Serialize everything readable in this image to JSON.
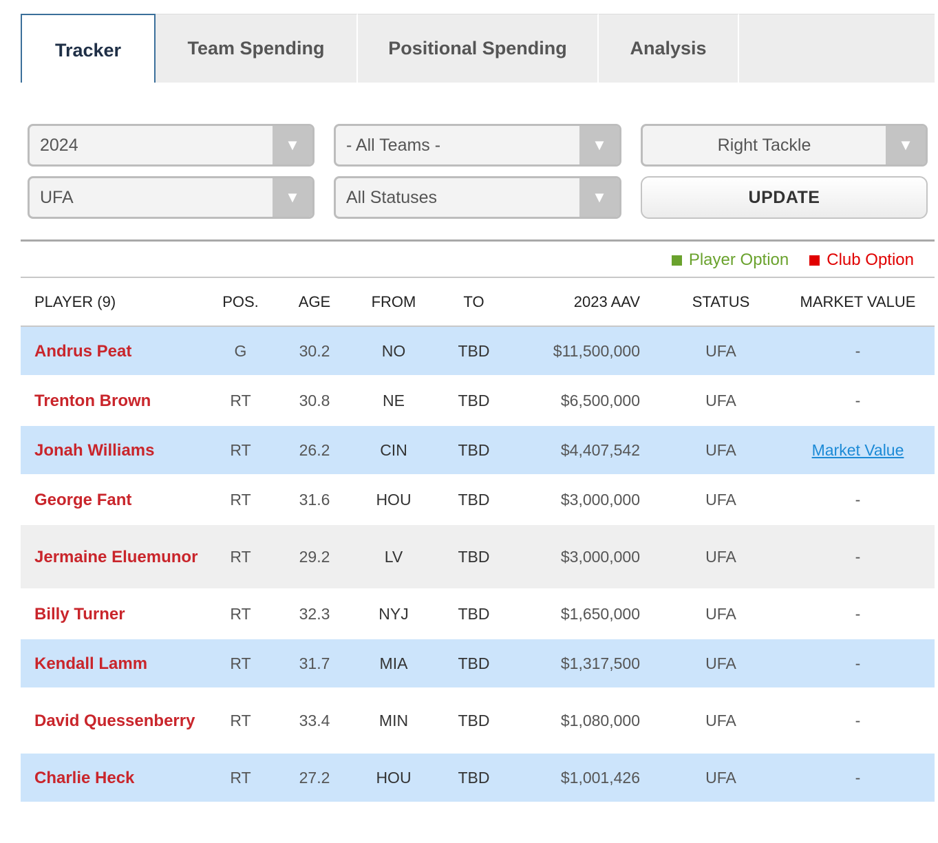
{
  "tabs": [
    {
      "label": "Tracker",
      "active": true
    },
    {
      "label": "Team Spending",
      "active": false
    },
    {
      "label": "Positional Spending",
      "active": false
    },
    {
      "label": "Analysis",
      "active": false
    }
  ],
  "filters": {
    "year": "2024",
    "team": "- All Teams -",
    "position": "Right Tackle",
    "type": "UFA",
    "status": "All Statuses",
    "update_label": "UPDATE"
  },
  "legend": {
    "player_option": "Player Option",
    "player_option_color": "#6aa22d",
    "club_option": "Club Option",
    "club_option_color": "#e00000"
  },
  "table": {
    "headers": [
      "PLAYER (9)",
      "POS.",
      "AGE",
      "FROM",
      "TO",
      "2023 AAV",
      "STATUS",
      "MARKET VALUE"
    ],
    "rows": [
      {
        "player": "Andrus Peat",
        "pos": "G",
        "age": "30.2",
        "from": "NO",
        "to": "TBD",
        "aav": "$11,500,000",
        "status": "UFA",
        "mv": "-"
      },
      {
        "player": "Trenton Brown",
        "pos": "RT",
        "age": "30.8",
        "from": "NE",
        "to": "TBD",
        "aav": "$6,500,000",
        "status": "UFA",
        "mv": "-"
      },
      {
        "player": "Jonah Williams",
        "pos": "RT",
        "age": "26.2",
        "from": "CIN",
        "to": "TBD",
        "aav": "$4,407,542",
        "status": "UFA",
        "mv": "Market Value"
      },
      {
        "player": "George Fant",
        "pos": "RT",
        "age": "31.6",
        "from": "HOU",
        "to": "TBD",
        "aav": "$3,000,000",
        "status": "UFA",
        "mv": "-"
      },
      {
        "player": "Jermaine Eluemunor",
        "pos": "RT",
        "age": "29.2",
        "from": "LV",
        "to": "TBD",
        "aav": "$3,000,000",
        "status": "UFA",
        "mv": "-"
      },
      {
        "player": "Billy Turner",
        "pos": "RT",
        "age": "32.3",
        "from": "NYJ",
        "to": "TBD",
        "aav": "$1,650,000",
        "status": "UFA",
        "mv": "-"
      },
      {
        "player": "Kendall Lamm",
        "pos": "RT",
        "age": "31.7",
        "from": "MIA",
        "to": "TBD",
        "aav": "$1,317,500",
        "status": "UFA",
        "mv": "-"
      },
      {
        "player": "David Quessenberry",
        "pos": "RT",
        "age": "33.4",
        "from": "MIN",
        "to": "TBD",
        "aav": "$1,080,000",
        "status": "UFA",
        "mv": "-"
      },
      {
        "player": "Charlie Heck",
        "pos": "RT",
        "age": "27.2",
        "from": "HOU",
        "to": "TBD",
        "aav": "$1,001,426",
        "status": "UFA",
        "mv": "-"
      }
    ]
  }
}
